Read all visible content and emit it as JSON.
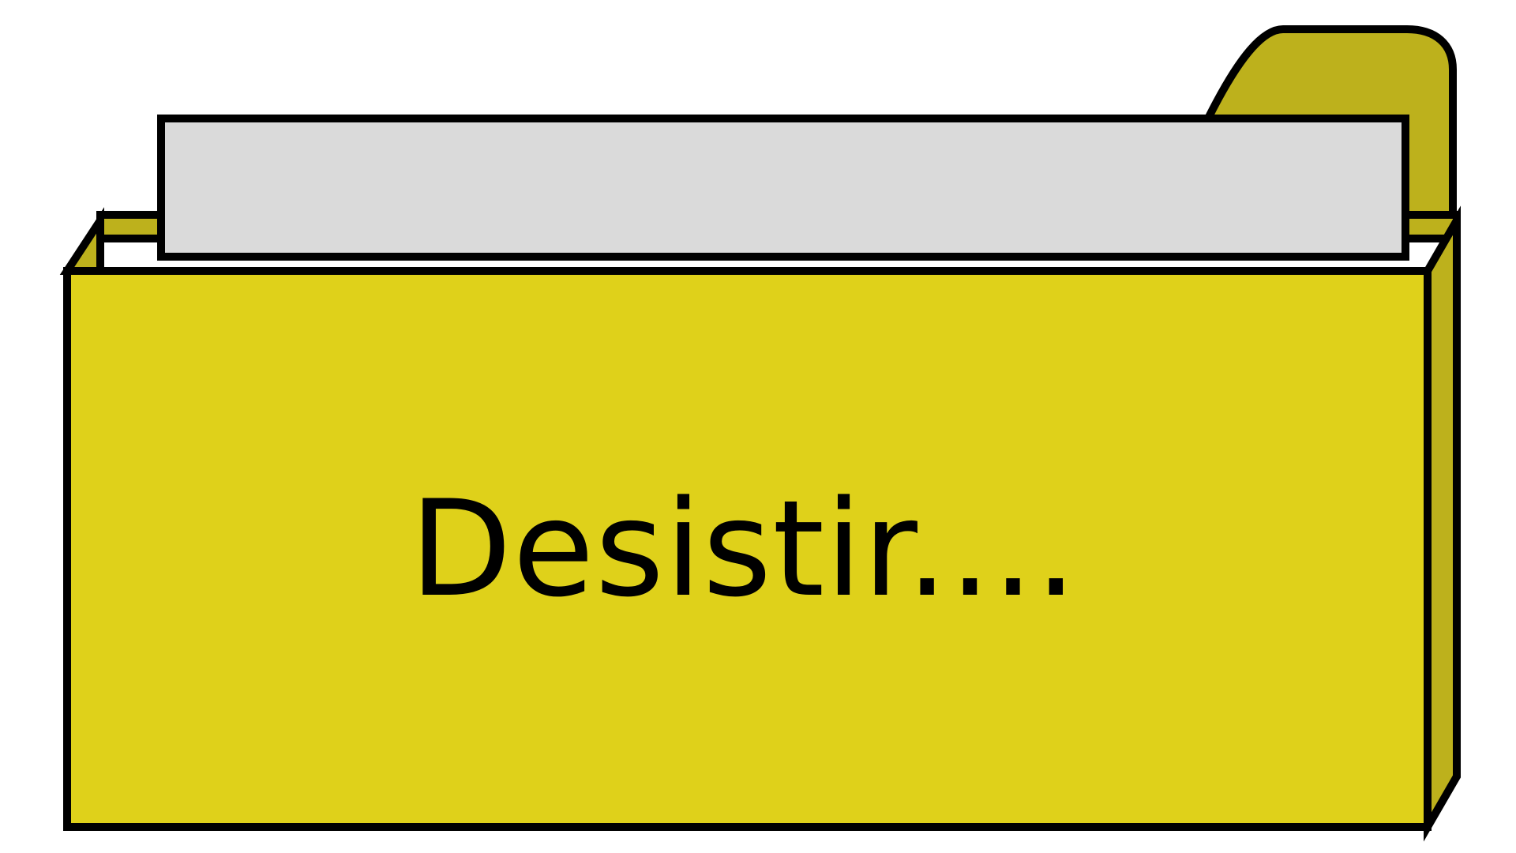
{
  "folder": {
    "label": "Desistir....",
    "colors": {
      "front": "#dfd11a",
      "back": "#bdb11c",
      "paper": "#dadada",
      "outline": "#000000"
    }
  }
}
